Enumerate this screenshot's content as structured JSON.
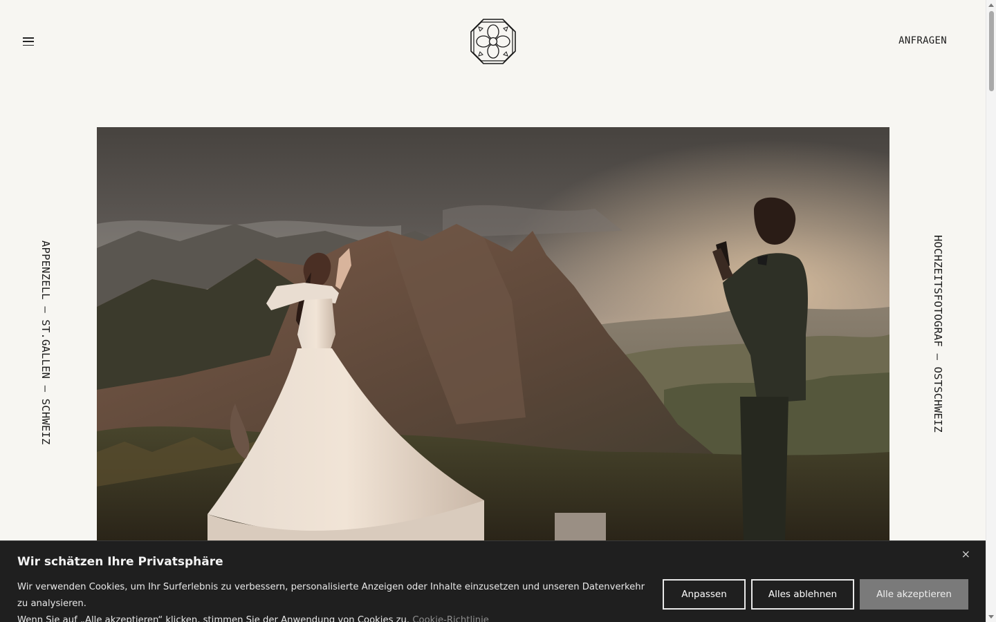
{
  "header": {
    "cta_label": "ANFRAGEN"
  },
  "side": {
    "left": "APPENZELL – ST.GALLEN – SCHWEIZ",
    "right": "HOCHZEITSFOTOGRAF – OSTSCHWEIZ"
  },
  "icons": {
    "menu": "hamburger-menu-icon",
    "logo": "flower-emblem-logo",
    "close": "close-icon"
  },
  "cookie": {
    "title": "Wir schätzen Ihre Privatsphäre",
    "text_line1": "Wir verwenden Cookies, um Ihr Surferlebnis zu verbessern, personalisierte Anzeigen oder Inhalte einzusetzen und unseren Datenverkehr zu analysieren.",
    "text_line2": "Wenn Sie auf „Alle akzeptieren“ klicken, stimmen Sie der Anwendung von Cookies zu.",
    "link": "Cookie-Richtlinie",
    "close": "×",
    "buttons": {
      "customize": "Anpassen",
      "reject": "Alles ablehnen",
      "accept": "Alle akzeptieren"
    }
  },
  "colors": {
    "background": "#f7f6f2",
    "banner": "#1f1f1f",
    "accept_button": "#7a7a7a"
  }
}
